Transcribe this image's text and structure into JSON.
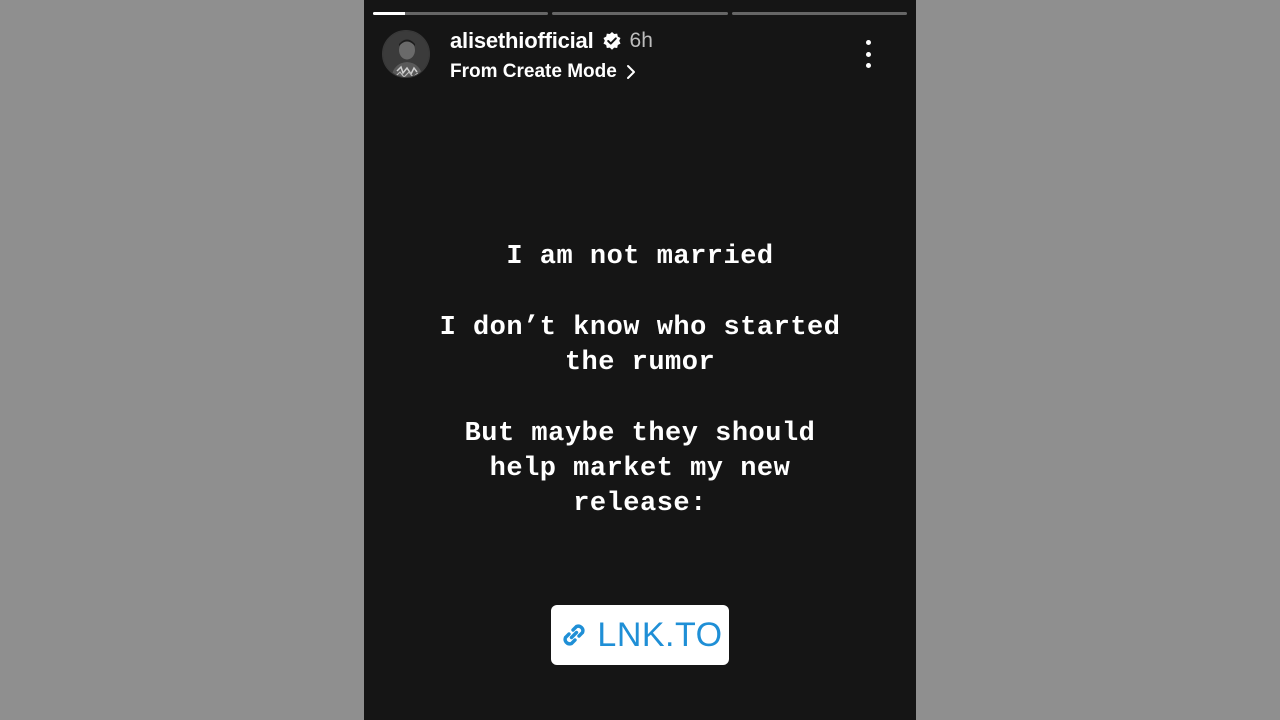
{
  "story": {
    "progress": [
      0.18,
      0,
      0
    ],
    "header": {
      "username": "alisethiofficial",
      "verified": true,
      "timestamp": "6h",
      "subtitle": "From Create Mode",
      "avatar_icon": "profile-avatar",
      "verified_icon": "verified-badge-icon",
      "chevron_icon": "chevron-right-icon",
      "more_icon": "more-vertical-icon"
    },
    "message": {
      "line1": "I am not married",
      "line2a": "I don’t know who started",
      "line2b": "the rumor",
      "line3a": "But maybe they should",
      "line3b": "help market my new",
      "line3c": "release:"
    },
    "link_sticker": {
      "label": "LNK.TO",
      "icon": "link-icon",
      "color": "#1f8fd6"
    }
  }
}
